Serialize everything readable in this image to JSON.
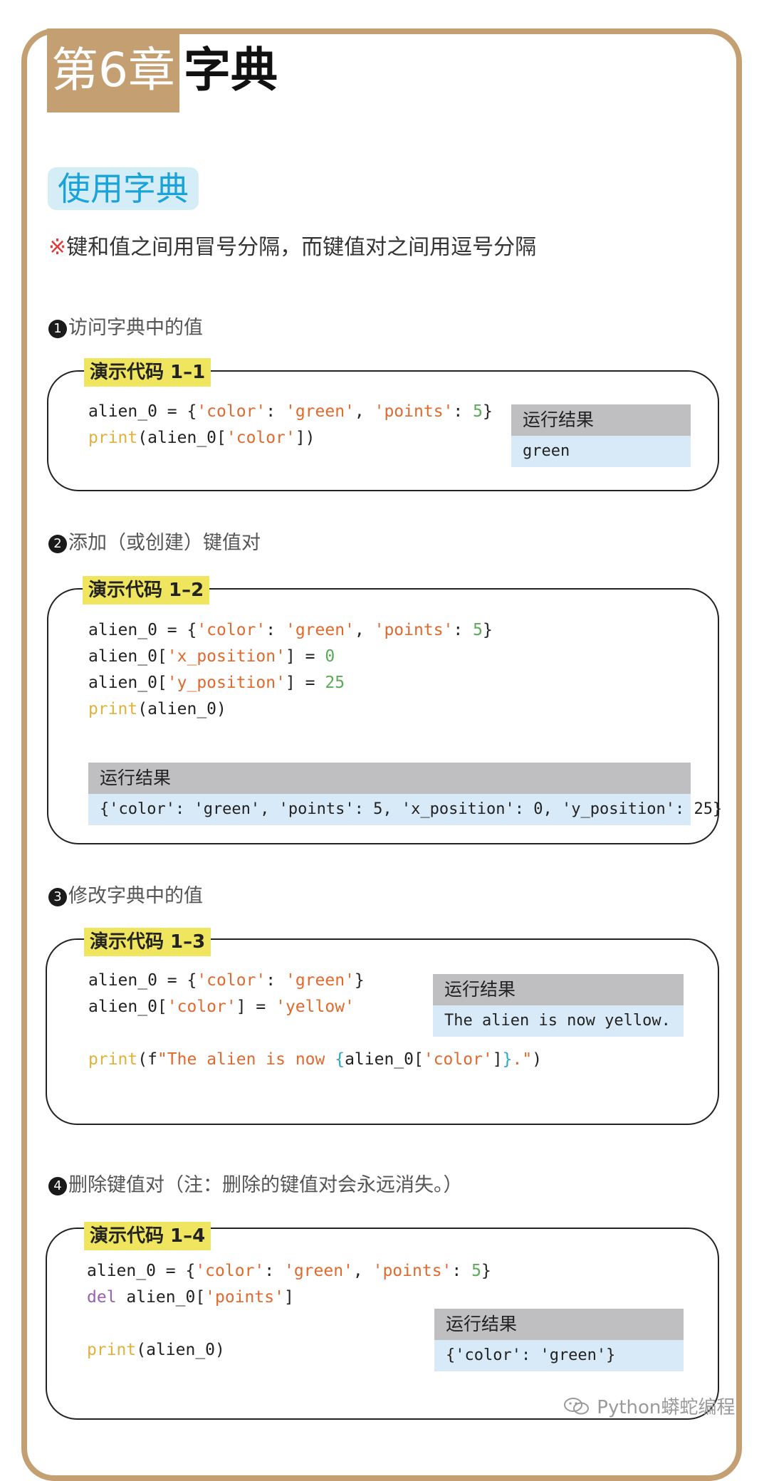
{
  "chapter": {
    "badge": "第6章",
    "title": "字典"
  },
  "section": {
    "title": "使用字典"
  },
  "note": {
    "mark": "※",
    "text": "键和值之间用冒号分隔，而键值对之间用逗号分隔"
  },
  "result_label": "运行结果",
  "subsections": [
    {
      "number": "1",
      "title": "访问字典中的值",
      "label": "演示代码 1–1",
      "code": [
        [
          {
            "t": "alien_0 = {"
          },
          {
            "t": "'color'",
            "c": "str"
          },
          {
            "t": ": "
          },
          {
            "t": "'green'",
            "c": "str"
          },
          {
            "t": ", "
          },
          {
            "t": "'points'",
            "c": "str"
          },
          {
            "t": ": "
          },
          {
            "t": "5",
            "c": "num"
          },
          {
            "t": "}"
          }
        ],
        [
          {
            "t": "print",
            "c": "fn"
          },
          {
            "t": "(alien_0["
          },
          {
            "t": "'color'",
            "c": "str"
          },
          {
            "t": "])"
          }
        ]
      ],
      "result": "green"
    },
    {
      "number": "2",
      "title": "添加（或创建）键值对",
      "label": "演示代码 1–2",
      "code": [
        [
          {
            "t": "alien_0 = {"
          },
          {
            "t": "'color'",
            "c": "str"
          },
          {
            "t": ": "
          },
          {
            "t": "'green'",
            "c": "str"
          },
          {
            "t": ", "
          },
          {
            "t": "'points'",
            "c": "str"
          },
          {
            "t": ": "
          },
          {
            "t": "5",
            "c": "num"
          },
          {
            "t": "}"
          }
        ],
        [
          {
            "t": "alien_0["
          },
          {
            "t": "'x_position'",
            "c": "str"
          },
          {
            "t": "] = "
          },
          {
            "t": "0",
            "c": "num"
          }
        ],
        [
          {
            "t": "alien_0["
          },
          {
            "t": "'y_position'",
            "c": "str"
          },
          {
            "t": "] = "
          },
          {
            "t": "25",
            "c": "num"
          }
        ],
        [
          {
            "t": "print",
            "c": "fn"
          },
          {
            "t": "(alien_0)"
          }
        ]
      ],
      "result": "{'color': 'green', 'points': 5, 'x_position': 0, 'y_position': 25}"
    },
    {
      "number": "3",
      "title": "修改字典中的值",
      "label": "演示代码 1–3",
      "code": [
        [
          {
            "t": "alien_0 = {"
          },
          {
            "t": "'color'",
            "c": "str"
          },
          {
            "t": ": "
          },
          {
            "t": "'green'",
            "c": "str"
          },
          {
            "t": "}"
          }
        ],
        [
          {
            "t": "alien_0["
          },
          {
            "t": "'color'",
            "c": "str"
          },
          {
            "t": "] = "
          },
          {
            "t": "'yellow'",
            "c": "str"
          }
        ],
        [],
        [
          {
            "t": "print",
            "c": "fn"
          },
          {
            "t": "(f"
          },
          {
            "t": "\"The alien is now ",
            "c": "str"
          },
          {
            "t": "{",
            "c": "brace"
          },
          {
            "t": "alien_0["
          },
          {
            "t": "'color'",
            "c": "str"
          },
          {
            "t": "]"
          },
          {
            "t": "}",
            "c": "brace"
          },
          {
            "t": ".\"",
            "c": "str"
          },
          {
            "t": ")"
          }
        ]
      ],
      "result": "The alien is now yellow."
    },
    {
      "number": "4",
      "title": "删除键值对（注：删除的键值对会永远消失。）",
      "label": "演示代码 1–4",
      "code": [
        [
          {
            "t": "alien_0 = {"
          },
          {
            "t": "'color'",
            "c": "str"
          },
          {
            "t": ": "
          },
          {
            "t": "'green'",
            "c": "str"
          },
          {
            "t": ", "
          },
          {
            "t": "'points'",
            "c": "str"
          },
          {
            "t": ": "
          },
          {
            "t": "5",
            "c": "num"
          },
          {
            "t": "}"
          }
        ],
        [
          {
            "t": "del",
            "c": "kw"
          },
          {
            "t": " alien_0["
          },
          {
            "t": "'points'",
            "c": "str"
          },
          {
            "t": "]"
          }
        ],
        [],
        [
          {
            "t": "print",
            "c": "fn"
          },
          {
            "t": "(alien_0)"
          }
        ]
      ],
      "result": "{'color': 'green'}"
    }
  ],
  "watermark": "Python蟒蛇编程",
  "colors": {
    "frame": "#c49f72",
    "section_text": "#1aa3d9",
    "label_bg": "#f0e55e",
    "result_head": "#bfbfc1",
    "result_body": "#d8eaf7"
  }
}
